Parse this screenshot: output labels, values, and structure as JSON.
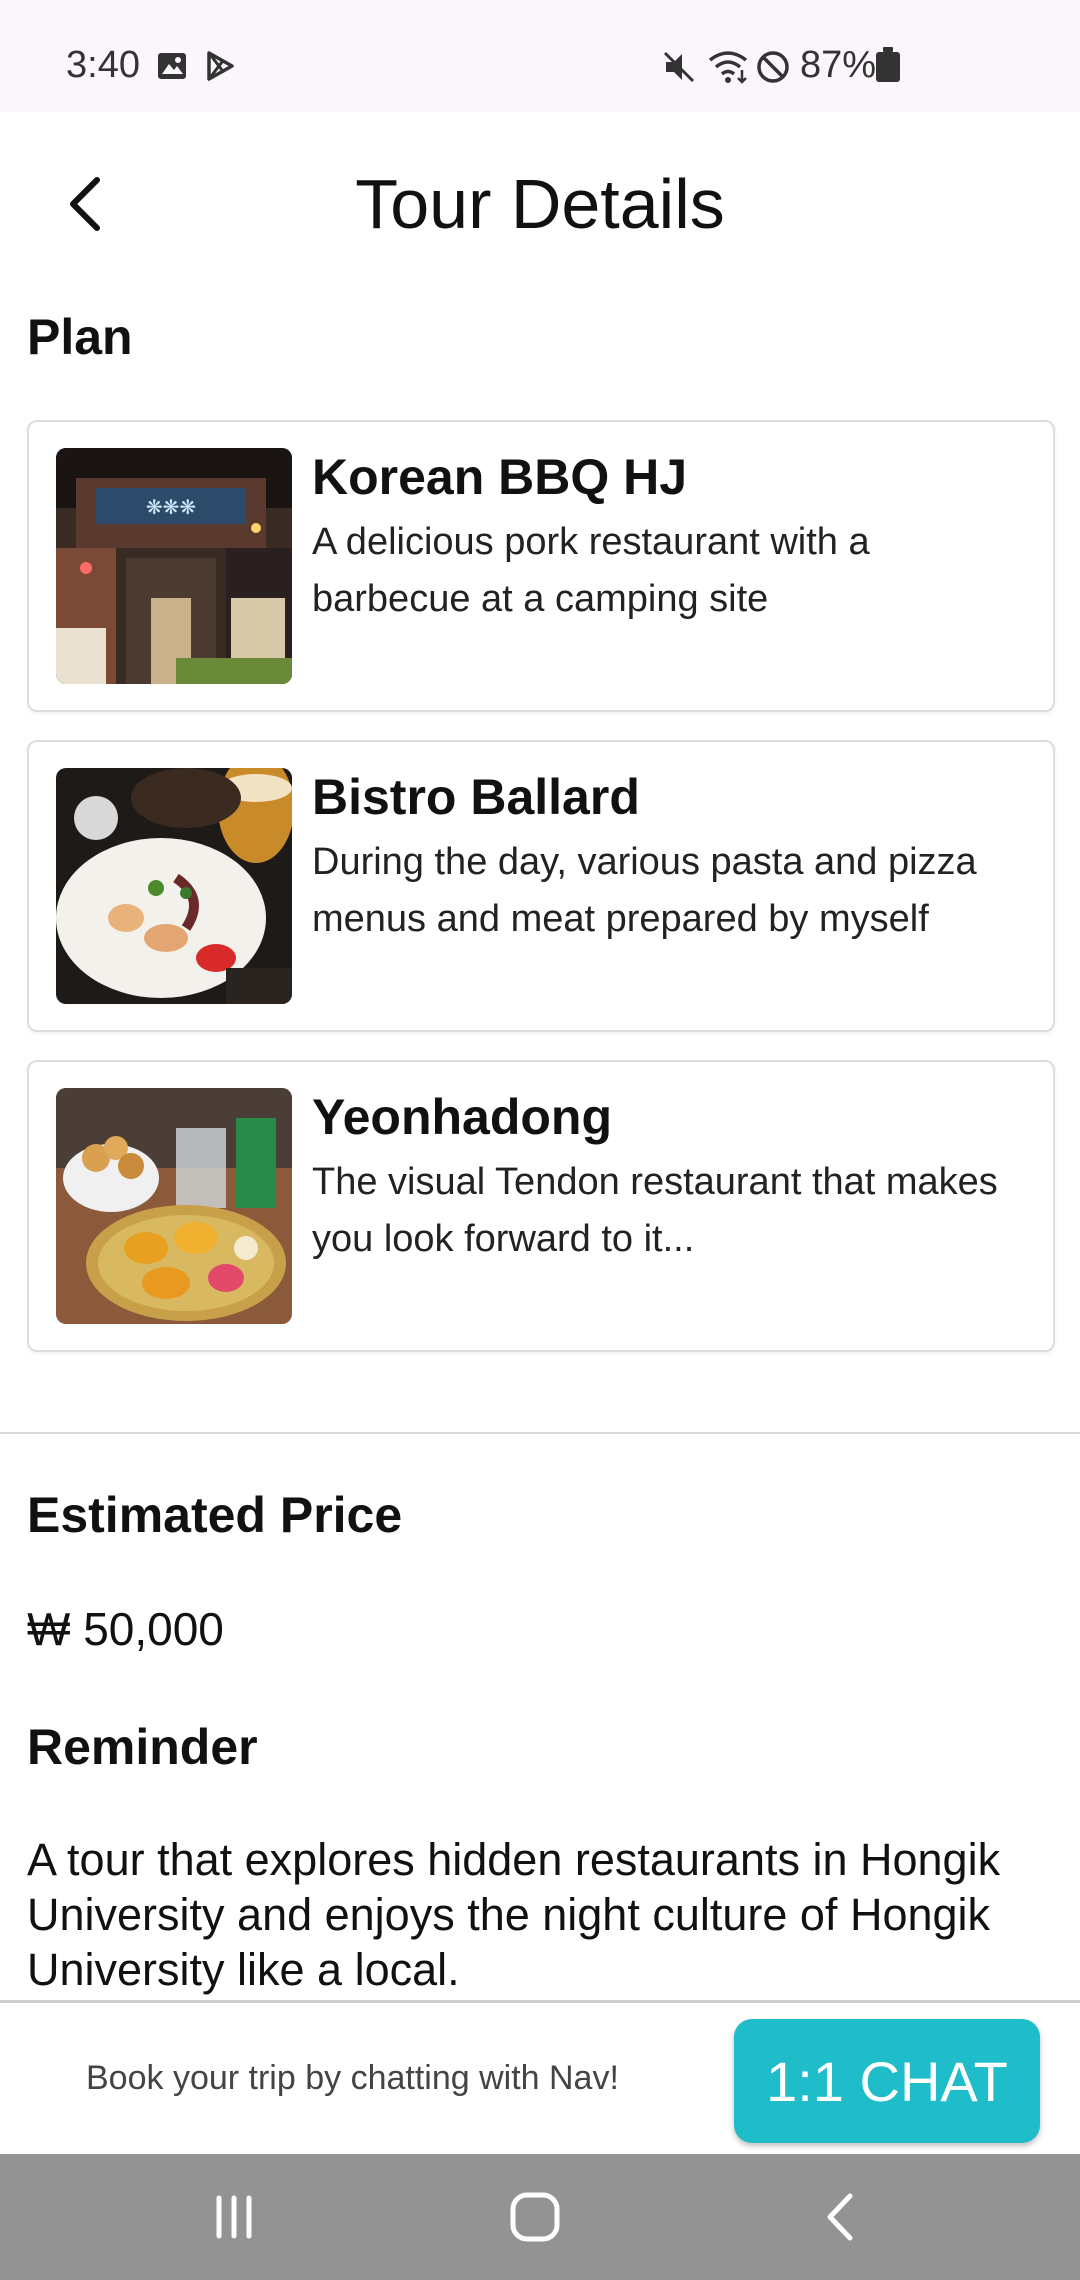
{
  "status_bar": {
    "time": "3:40",
    "battery": "87%",
    "icons_left": [
      "image-icon",
      "play-store-icon"
    ],
    "icons_right": [
      "mute-icon",
      "wifi-icon",
      "do-not-disturb-icon",
      "battery-icon"
    ]
  },
  "header": {
    "title": "Tour Details"
  },
  "plan": {
    "title": "Plan",
    "items": [
      {
        "name": "Korean BBQ HJ",
        "description": "A delicious pork restaurant with a barbecue at a camping site"
      },
      {
        "name": "Bistro Ballard",
        "description": "During the day, various pasta and pizza menus and meat prepared by myself"
      },
      {
        "name": "Yeonhadong",
        "description": "The visual Tendon restaurant that makes you look forward to it..."
      }
    ]
  },
  "estimated_price": {
    "title": "Estimated Price",
    "value": "₩ 50,000"
  },
  "reminder": {
    "title": "Reminder",
    "text": "A tour that explores hidden restaurants in Hongik University and enjoys the night culture of Hongik University like a local."
  },
  "booking": {
    "prompt": "Book your trip by chatting with Nav!",
    "button_label": "1:1 CHAT"
  },
  "colors": {
    "accent": "#1fbcc9",
    "nav_bar": "#939393",
    "status_bar": "#fbf6fb"
  }
}
